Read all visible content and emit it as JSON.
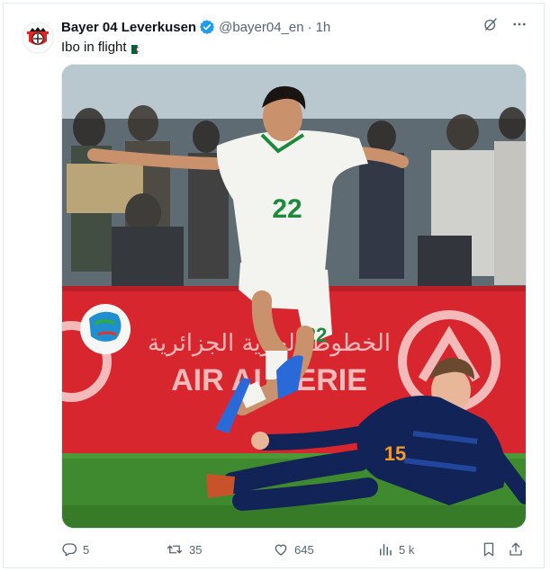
{
  "author": {
    "display_name": "Bayer 04 Leverkusen",
    "handle": "@bayer04_en",
    "separator": "·",
    "time": "1h"
  },
  "tweet": {
    "text": "Ibo in flight"
  },
  "media": {
    "banner_text": "AIR ALGERIE",
    "banner_arabic": "الخطوط الجوية الجزائرية",
    "player_one_number": "22",
    "player_two_number": "15"
  },
  "actions": {
    "replies": "5",
    "reposts": "35",
    "likes": "645",
    "views": "5 k"
  },
  "colors": {
    "verified": "#1d9bf0",
    "muted": "#536471",
    "banner_red": "#d8262f",
    "pitch_green": "#3f8a2e"
  },
  "icons": {
    "more": "more-icon",
    "grok": "grok-icon",
    "reply": "reply-icon",
    "repost": "repost-icon",
    "like": "heart-icon",
    "views": "views-icon",
    "bookmark": "bookmark-icon",
    "share": "share-icon"
  }
}
